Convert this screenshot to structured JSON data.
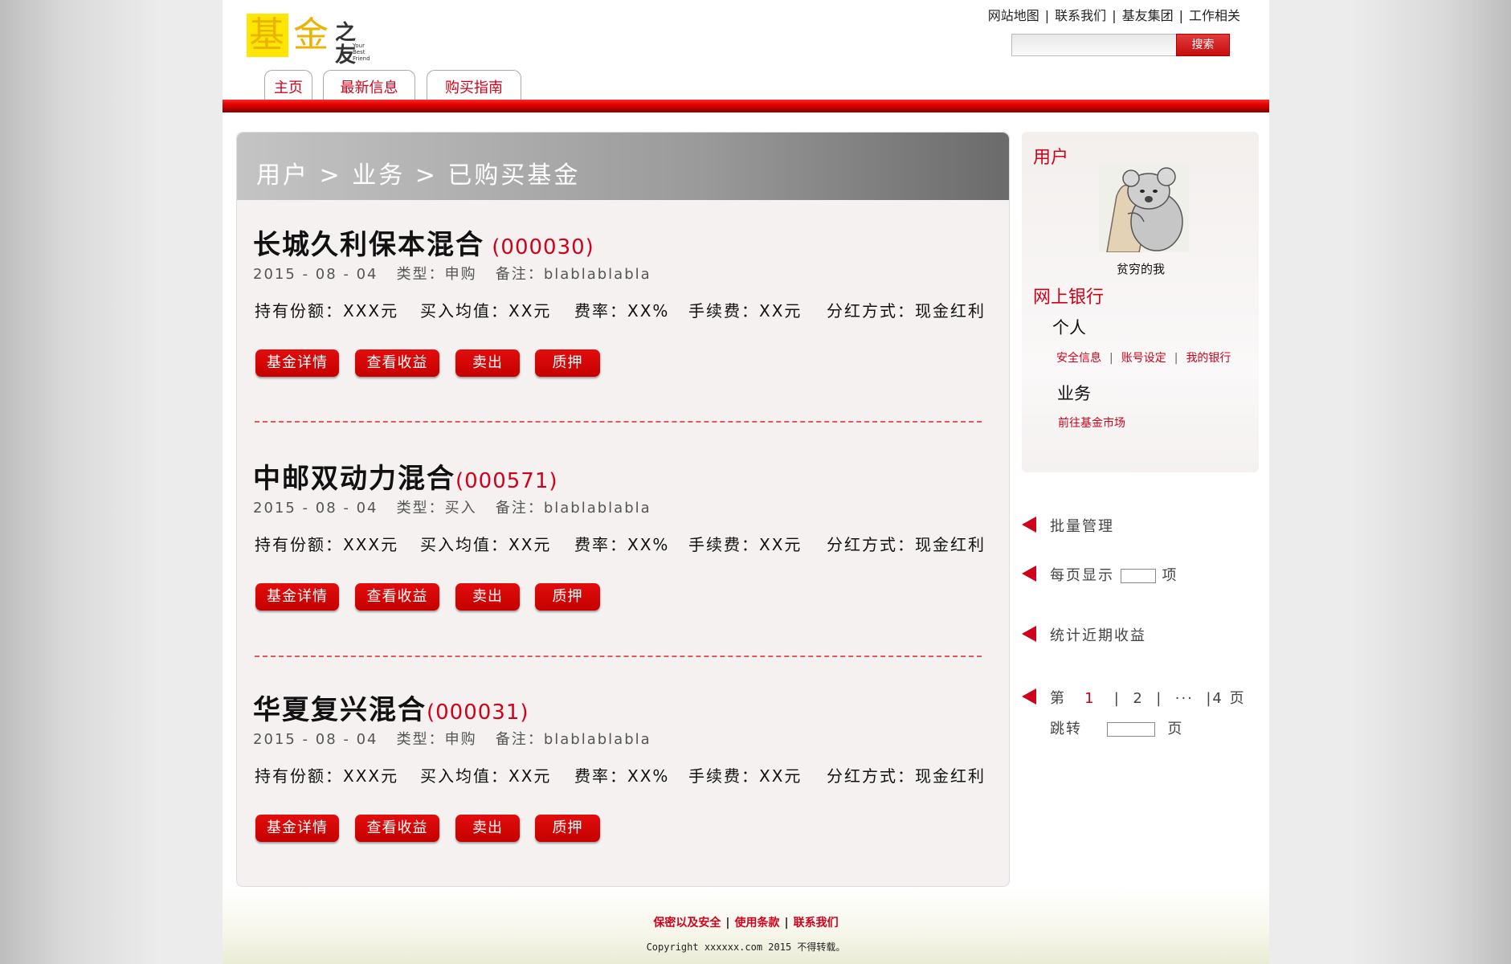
{
  "header": {
    "logo": {
      "char1": "基",
      "char2": "金",
      "char3": "之友",
      "tagline": "Your Best Friend"
    },
    "top_links": [
      "网站地图",
      "联系我们",
      "基友集团",
      "工作相关"
    ],
    "search": {
      "value": "",
      "button_label": "搜索"
    },
    "tabs": [
      "主页",
      "最新信息",
      "购买指南"
    ]
  },
  "breadcrumb": "用户 > 业务 > 已购买基金",
  "funds": [
    {
      "name": "长城久利保本混合",
      "code": " (000030)",
      "date": "2015 - 08 - 04",
      "type": "类型：申购",
      "note": "备注：blablablabla",
      "holding": "持有份额：XXX元",
      "avg_price": "买入均值：XX元",
      "rate": "费率：XX%",
      "fee": "手续费：XX元",
      "dividend": "分红方式：现金红利",
      "buttons": [
        "基金详情",
        "查看收益",
        "卖出",
        "质押"
      ]
    },
    {
      "name": "中邮双动力混合",
      "code": "(000571)",
      "date": "2015 - 08 - 04",
      "type": "类型：买入",
      "note": "备注：blablablabla",
      "holding": "持有份额：XXX元",
      "avg_price": "买入均值：XX元",
      "rate": "费率：XX%",
      "fee": "手续费：XX元",
      "dividend": "分红方式：现金红利",
      "buttons": [
        "基金详情",
        "查看收益",
        "卖出",
        "质押"
      ]
    },
    {
      "name": "华夏复兴混合",
      "code": "(000031)",
      "date": "2015 - 08 - 04",
      "type": "类型：申购",
      "note": "备注：blablablabla",
      "holding": "持有份额：XXX元",
      "avg_price": "买入均值：XX元",
      "rate": "费率：XX%",
      "fee": "手续费：XX元",
      "dividend": "分红方式：现金红利",
      "buttons": [
        "基金详情",
        "查看收益",
        "卖出",
        "质押"
      ]
    }
  ],
  "sidebar": {
    "user_heading": "用户",
    "username": "贫穷的我",
    "bank_heading": "网上银行",
    "personal_label": "个人",
    "personal_links": [
      "安全信息",
      "账号设定",
      "我的银行"
    ],
    "business_label": "业务",
    "business_link": "前往基金市场"
  },
  "actions": {
    "batch": "批量管理",
    "per_page_prefix": "每页显示",
    "per_page_suffix": "项",
    "per_page_value": "",
    "stats": "统计近期收益",
    "page_prefix": "第",
    "page_current": "1",
    "page_2": "2",
    "page_ellipsis": "···",
    "page_last": "4 页",
    "jump_prefix": "跳转",
    "jump_suffix": "页",
    "jump_value": ""
  },
  "footer": {
    "links": [
      "保密以及安全",
      "使用条款",
      "联系我们"
    ],
    "copyright": "Copyright xxxxxx.com 2015 不得转载。"
  },
  "colors": {
    "accent_red": "#d0021b",
    "logo_yellow": "#ffe600"
  }
}
